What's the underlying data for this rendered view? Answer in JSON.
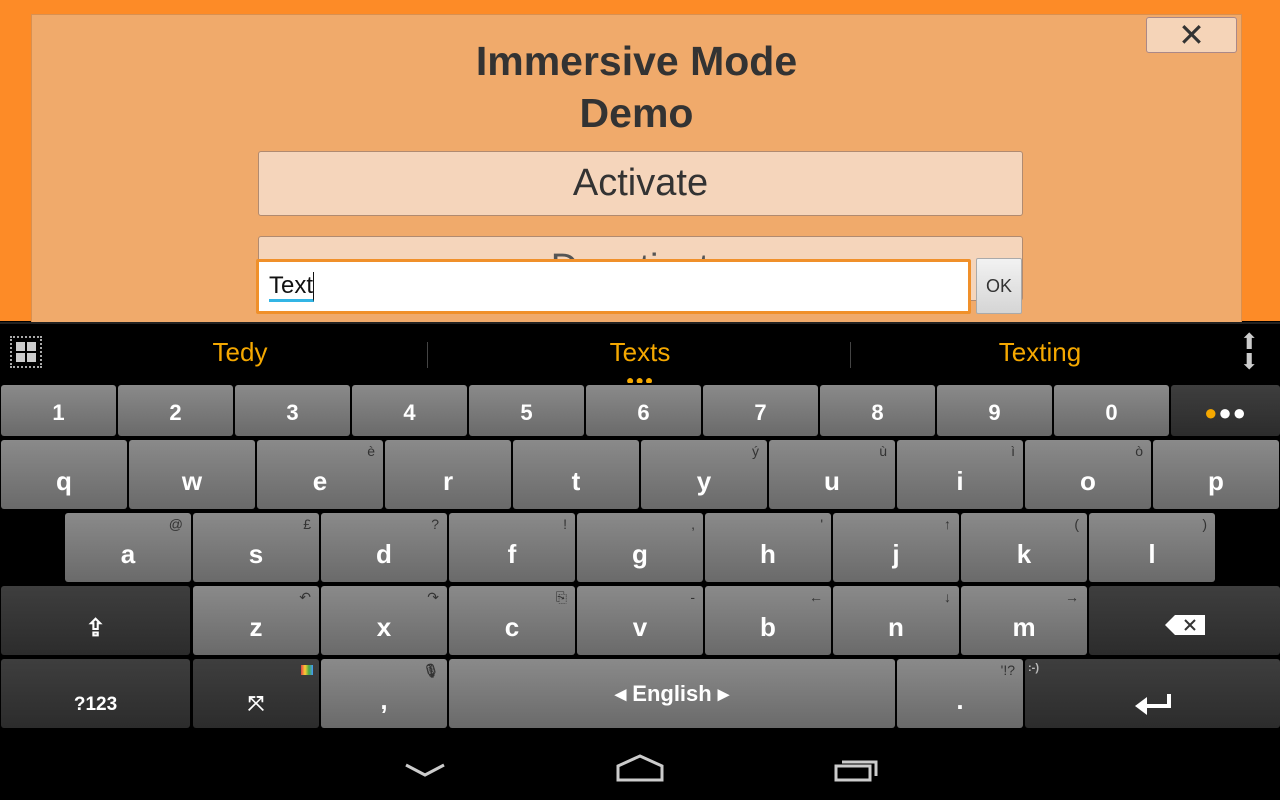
{
  "app": {
    "title_line1": "Immersive Mode",
    "title_line2": "Demo",
    "close_label": "✕",
    "activate_label": "Activate",
    "deactivate_label": "Deactivate",
    "input_value": "Text",
    "ok_label": "OK"
  },
  "suggestions": [
    "Tedy",
    "Texts",
    "Texting"
  ],
  "colors": {
    "accent": "#f5a800",
    "app_bg": "#fd8b27",
    "dialog_bg": "#f0aa6b"
  },
  "keyboard": {
    "row_numbers": [
      "1",
      "2",
      "3",
      "4",
      "5",
      "6",
      "7",
      "8",
      "9",
      "0"
    ],
    "more_label": "•••",
    "row1": [
      [
        "q",
        ""
      ],
      [
        "w",
        ""
      ],
      [
        "e",
        "è"
      ],
      [
        "r",
        ""
      ],
      [
        "t",
        ""
      ],
      [
        "y",
        "ý"
      ],
      [
        "u",
        "ù"
      ],
      [
        "i",
        "ì"
      ],
      [
        "o",
        "ò"
      ],
      [
        "p",
        ""
      ]
    ],
    "row2": [
      [
        "a",
        "@"
      ],
      [
        "s",
        "£"
      ],
      [
        "d",
        "?"
      ],
      [
        "f",
        "!"
      ],
      [
        "g",
        ","
      ],
      [
        "h",
        "'"
      ],
      [
        "j",
        "↑"
      ],
      [
        "k",
        "("
      ],
      [
        "l",
        ")"
      ]
    ],
    "row3": [
      [
        "z",
        "↶"
      ],
      [
        "x",
        "↷"
      ],
      [
        "c",
        "⎘"
      ],
      [
        "v",
        "-"
      ],
      [
        "b",
        "←"
      ],
      [
        "n",
        "↓"
      ],
      [
        "m",
        "→"
      ]
    ],
    "symbols_label": "?123",
    "comma_label": ",",
    "space_label": "◂ English ▸",
    "period_label": ".",
    "period_hint": "'!?",
    "smiley_hint": ":-)"
  },
  "icons": {
    "shift": "shift-icon",
    "backspace": "backspace-icon",
    "enter": "enter-icon",
    "layout": "move-arrows-icon",
    "mic": "mic-icon",
    "grid": "grid-icon",
    "resize": "resize-icon"
  }
}
